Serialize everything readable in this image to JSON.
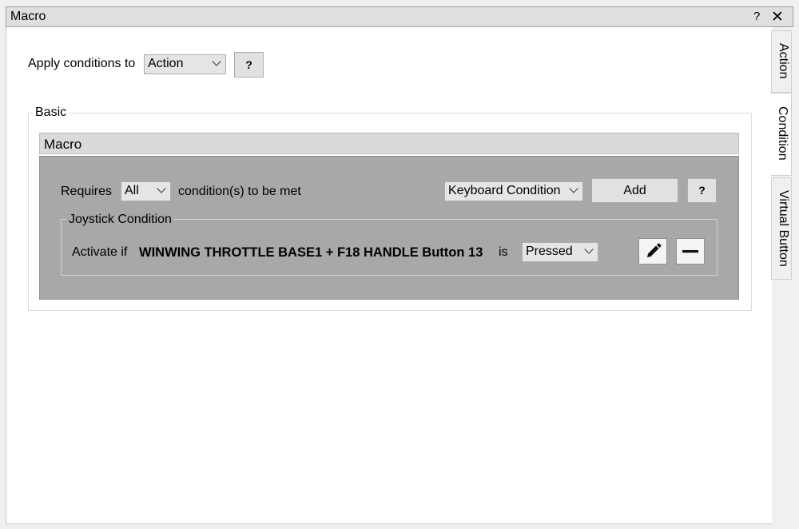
{
  "window": {
    "title": "Macro",
    "help_label": "?",
    "close_label": "✕"
  },
  "apply": {
    "label": "Apply conditions to",
    "value": "Action",
    "help_label": "?"
  },
  "basic": {
    "group_title": "Basic",
    "macro_header": "Macro",
    "requires_label": "Requires",
    "requires_value": "All",
    "requires_suffix": "condition(s) to be met",
    "condition_type": "Keyboard Condition",
    "add_label": "Add",
    "help_label": "?"
  },
  "joystick": {
    "title": "Joystick Condition",
    "activate_label": "Activate if",
    "input_name": "WINWING THROTTLE BASE1 + F18 HANDLE Button 13",
    "is_label": "is",
    "state_value": "Pressed"
  },
  "icons": {
    "edit": "pencil-icon",
    "remove": "minus-icon",
    "dropdown": "chevron-down-icon"
  },
  "tabs": [
    {
      "label": "Action",
      "active": false
    },
    {
      "label": "Condition",
      "active": true
    },
    {
      "label": "Virtual Button",
      "active": false
    }
  ]
}
